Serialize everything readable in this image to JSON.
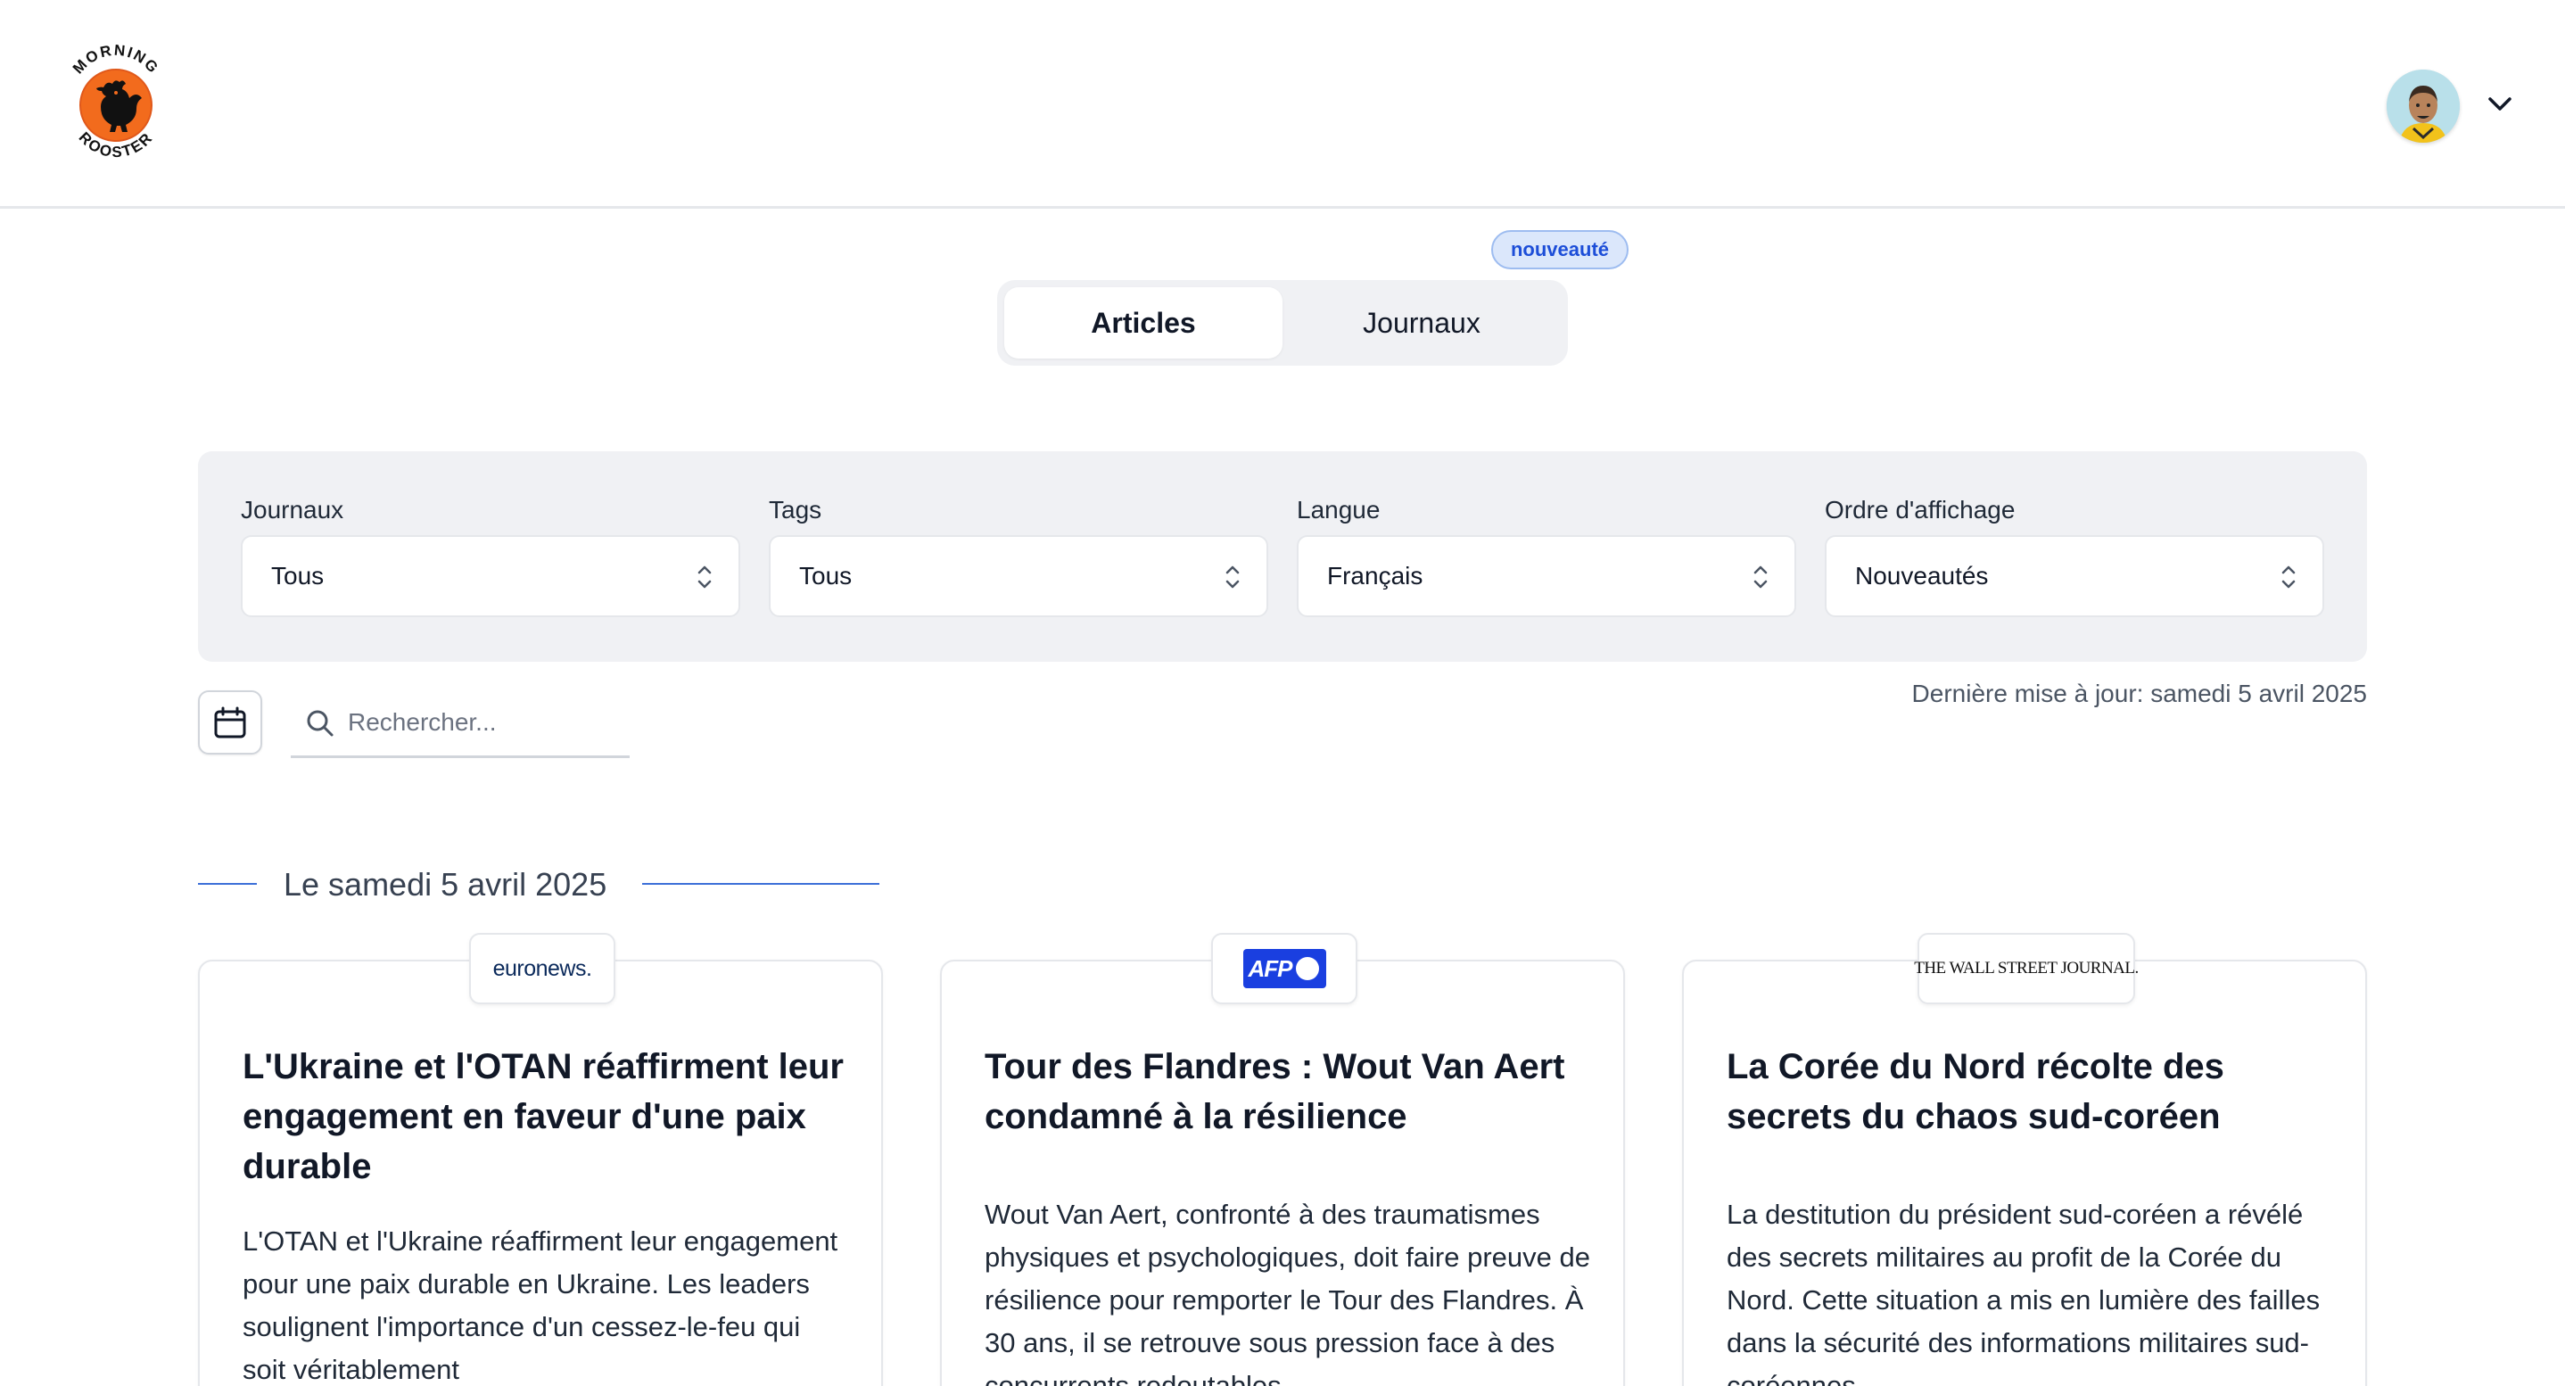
{
  "header": {
    "logo_top": "MORNING",
    "logo_bottom": "ROOSTER",
    "avatar_icon": "user-avatar-icon",
    "chevron_icon": "chevron-down-icon"
  },
  "tabs": {
    "badge": "nouveauté",
    "items": [
      {
        "label": "Articles",
        "active": true
      },
      {
        "label": "Journaux",
        "active": false
      }
    ]
  },
  "filters": [
    {
      "label": "Journaux",
      "value": "Tous"
    },
    {
      "label": "Tags",
      "value": "Tous"
    },
    {
      "label": "Langue",
      "value": "Français"
    },
    {
      "label": "Ordre d'affichage",
      "value": "Nouveautés"
    }
  ],
  "search": {
    "placeholder": "Rechercher...",
    "value": "",
    "calendar_icon": "calendar-icon"
  },
  "last_update": "Dernière mise à jour: samedi 5 avril 2025",
  "date_heading": "Le samedi 5 avril 2025",
  "articles": [
    {
      "source": "euronews.",
      "title": "L'Ukraine et l'OTAN réaffirment leur engagement en faveur d'une paix durable",
      "summary": "L'OTAN et l'Ukraine réaffirment leur engagement pour une paix durable en Ukraine. Les leaders soulignent l'importance d'un cessez-le-feu qui soit véritablement"
    },
    {
      "source": "AFP",
      "title": "Tour des Flandres : Wout Van Aert condamné à la résilience",
      "summary": "Wout Van Aert, confronté à des traumatismes physiques et psychologiques, doit faire preuve de résilience pour remporter le Tour des Flandres. À 30 ans, il se retrouve sous pression face à des concurrents redoutables"
    },
    {
      "source": "THE WALL STREET JOURNAL.",
      "title": "La Corée du Nord récolte des secrets du chaos sud-coréen",
      "summary": "La destitution du président sud-coréen a révélé des secrets militaires au profit de la Corée du Nord. Cette situation a mis en lumière des failles dans la sécurité des informations militaires sud-coréennes"
    }
  ],
  "colors": {
    "accent_blue": "#3b6fd8",
    "panel_gray": "#f0f1f4",
    "logo_orange": "#f26b1d",
    "afp_blue": "#1a3fe0",
    "euronews_navy": "#0b2a5b"
  }
}
